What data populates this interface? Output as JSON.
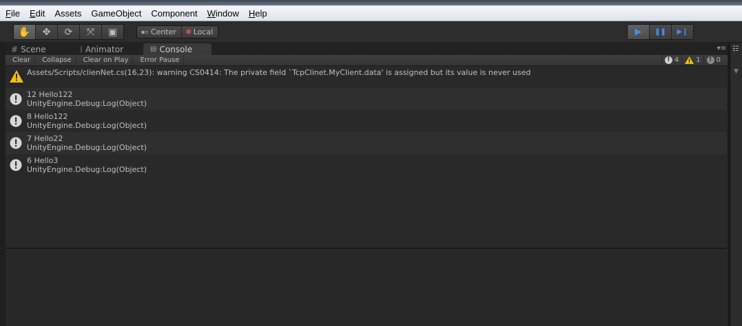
{
  "menubar": {
    "items": [
      "File",
      "Edit",
      "Assets",
      "GameObject",
      "Component",
      "Window",
      "Help"
    ]
  },
  "toolbar": {
    "tools": [
      {
        "name": "hand-tool",
        "icon": "hand-icon",
        "glyph": "✋",
        "active": true
      },
      {
        "name": "move-tool",
        "icon": "move-icon",
        "glyph": "✥",
        "active": false
      },
      {
        "name": "rotate-tool",
        "icon": "rotate-icon",
        "glyph": "⟳",
        "active": false
      },
      {
        "name": "scale-tool",
        "icon": "scale-icon",
        "glyph": "⤧",
        "active": false
      },
      {
        "name": "rect-tool",
        "icon": "rect-icon",
        "glyph": "▣",
        "active": false
      }
    ],
    "pivot_label": "Center",
    "space_label": "Local",
    "play": {
      "play_glyph": "▶",
      "pause_glyph": "❚❚",
      "step_glyph": "▶❙"
    }
  },
  "tabs": [
    {
      "label": "Scene",
      "icon": "scene-icon",
      "glyph": "#"
    },
    {
      "label": "Animator",
      "icon": "animator-icon",
      "glyph": "⁞"
    },
    {
      "label": "Console",
      "icon": "console-icon",
      "glyph": "▤",
      "active": true
    }
  ],
  "console": {
    "buttons": [
      "Clear",
      "Collapse",
      "Clear on Play",
      "Error Pause"
    ],
    "counters": {
      "log_count": "4",
      "warning_count": "1",
      "error_count": "0"
    },
    "entries": [
      {
        "type": "warning",
        "icon": "warning-icon",
        "line1": "Assets/Scripts/clienNet.cs(16,23): warning CS0414: The private field `TcpClinet.MyClient.data' is assigned but its value is never used",
        "line2": ""
      },
      {
        "type": "log",
        "icon": "info-icon",
        "line1": "12 Hello122",
        "line2": "UnityEngine.Debug:Log(Object)"
      },
      {
        "type": "log",
        "icon": "info-icon",
        "line1": "8 Hello122",
        "line2": "UnityEngine.Debug:Log(Object)"
      },
      {
        "type": "log",
        "icon": "info-icon",
        "line1": "7 Hello22",
        "line2": "UnityEngine.Debug:Log(Object)"
      },
      {
        "type": "log",
        "icon": "info-icon",
        "line1": "6 Hello3",
        "line2": "UnityEngine.Debug:Log(Object)"
      }
    ]
  },
  "colors": {
    "accent": "#3f8ff0",
    "warning": "#f2c012",
    "panel": "#2a2a2a"
  }
}
